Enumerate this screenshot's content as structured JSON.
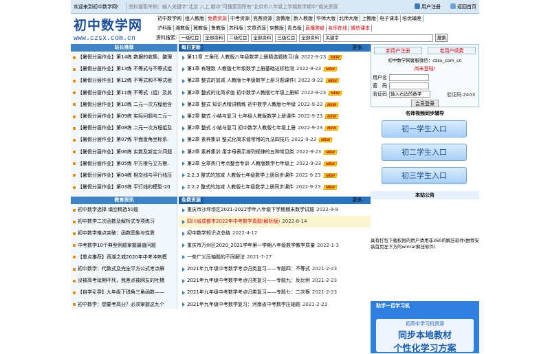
{
  "topbar": {
    "welcome": "欢迎来到初中数学网!",
    "marquee": "资料搜索举例：输入关键字\"北京 八上 期中\"可搜索到所有\"北京市八年级上学期数学期中\"相关资源",
    "register": "用户注册",
    "home": "返回首页"
  },
  "logo": {
    "title": "初中数学网",
    "url": "www.czsx.com.cn"
  },
  "nav": {
    "row1": [
      "初中数学网",
      "组人教版",
      "免费资源",
      "中考资源",
      "竞赛资源",
      "浙教版",
      "新人教版",
      "华师大版",
      "北师大版",
      "上教版",
      "电子课本",
      "培优辅差"
    ],
    "row2": [
      "沪科版",
      "湘教版",
      "冀教版",
      "鲁教版",
      "苏科版",
      "文章资源",
      "京教版",
      "青岛版",
      "直播答疑",
      "名师在线",
      "微信课本"
    ]
  },
  "search": {
    "label": "资料搜索:",
    "col1": "一级栏目",
    "sel1": "全部资料",
    "col2": "二级栏目",
    "sel2": "全部资料",
    "col3": "三级栏目",
    "sel3": "全部资料",
    "keyword": "关键字",
    "button": "搜索"
  },
  "left": {
    "head1": "站长推荐",
    "items1": [
      "【暑假分层作业】第14练 数据的收集、整理",
      "【暑假分层作业】第13练 不等式与不等式组",
      "【暑假分层作业】第12练 不等式和不等式组",
      "【暑假分层作业】第11练 不等式（组）及其",
      "【暑假分层作业】第10练 二元一次方程组含",
      "【暑假分层作业】第09练 实际问题与二元一",
      "【暑假分层作业】第08练 二元一次方程组及",
      "【暑假分层作业】第07练 平面直角坐标系.",
      "【暑假分层作业】第06练 实数及新定义问题",
      "【暑假分层作业】第05练 平方根与立方根.",
      "【暑假分层作业】第04练 相交线与平行线压",
      "【暑假分层作业】第03练 平行线的模型-20"
    ],
    "head2": "教育资讯",
    "items2": [
      "初中数学选择 填空精选50题",
      "初中数学二次函数及解析式专项练习",
      "初中数学难点突破：函数图象与性质",
      "中考数学10个典型例题掌握最值问题",
      "【重点推荐】西湖之城2020年中考冲刺模",
      "初中数学：代数式及完全平方公式考点解",
      "没被高考延期吓死，我差点被网友的吐槽",
      "【自学引导】九年级下锐角三角函数——",
      "初中数学：想要考高分？必须掌握这九个"
    ]
  },
  "mid": {
    "head1": "每日更新",
    "more": "更多..",
    "badge": "NEW",
    "items1": [
      {
        "t": "第11章 三角形 人教版八年级数学上册精选题练习(含",
        "d": "2022-9-23"
      },
      {
        "t": "第1章 有理数 人教版七年级数学上册基础达标检测",
        "d": "2022-9-23"
      },
      {
        "t": "第2章 整式的加减 人教版七年级数学上册习题课件(",
        "d": "2022-9-23"
      },
      {
        "t": "第2章 整式的化简求值 初中数学人教版七年级上册知",
        "d": "2022-9-23"
      },
      {
        "t": "第2章 整式 知识点精讲精练 初中数学人教版七年级",
        "d": "2022-9-23"
      },
      {
        "t": "第2章 整式 小结与复习 七年级人教版数学上册课件",
        "d": "2022-9-23"
      },
      {
        "t": "第2章 整式 小结与复习 初中数学人教版七年级上册",
        "d": "2022-9-23"
      },
      {
        "t": "第2章 素养集训 整式化简求值常用的九法四技巧",
        "d": "2022-9-23"
      },
      {
        "t": "第2章 素养集训 用字母表示排列规律的五种常见类",
        "d": "2022-9-23"
      },
      {
        "t": "第2章 全章热门考点整合专训 人教版数学七年级上",
        "d": "2022-9-23"
      },
      {
        "t": "2.2.3 整式的加减 人教版七年级数学上册同步课件",
        "d": "2022-9-23"
      },
      {
        "t": "2.2.2 整式的加减 人教版七年级数学上册同步课件",
        "d": "2022-9-23"
      }
    ],
    "head2": "免费资源",
    "items2": [
      {
        "t": "重庆市沙坪坝区2021-2022学年八年级下学期期末数学试题",
        "d": "2022-9-9"
      },
      {
        "t": "四川省成都市2022年中考数学真题(解析版)",
        "d": "2022-8-14"
      },
      {
        "t": "初中数学知识点总结",
        "d": "2022-4-17"
      },
      {
        "t": "重庆市万州区2020_2021学年第一学期八年级数学教学质量",
        "d": "2022-1-3"
      },
      {
        "t": "一些广义压轴题的不同解法",
        "d": "2021-7-27"
      },
      {
        "t": "2021年九年级中考数学考点归类复习——专题四：不等式",
        "d": "2021-2-23"
      },
      {
        "t": "2021年九年级中考数学考点归类复习——专题九：反比例",
        "d": "2021-2-23"
      },
      {
        "t": "2021年九年级中考数学考点归类复习——专题七：二次根",
        "d": "2021-2-23"
      },
      {
        "t": "2021年九年级中考数学复习：河南省中考数学压轴题",
        "d": "2021-2-23"
      }
    ]
  },
  "right": {
    "reg": "新用户注册",
    "renew": "老用户续费",
    "wechat": "初中数学网客服微信：czsx_com_cn",
    "notlogged": "尚未登陆!",
    "user_label": "用户名",
    "pwd_label": "密　码",
    "code_label": "验证码",
    "code_placeholder": "输入右边的数字",
    "code_value": "验证码:2403",
    "login_btn": "会员登录",
    "video_head": "名师视频同步辅导",
    "btn1": "初一学生入口",
    "btn2": "初二学生入口",
    "btn3": "初三学生入口",
    "notice_head": "本站公告",
    "notice": "具有打包下载权限的用户请用非360的解压软件(推荐安装首页左下方的winrar解压软件)",
    "ad_brand": "助学一百学习机",
    "ad_line1": "初高中学习机资源",
    "ad_line2": "同步本地教材",
    "ad_line3": "个性化学习方案"
  }
}
